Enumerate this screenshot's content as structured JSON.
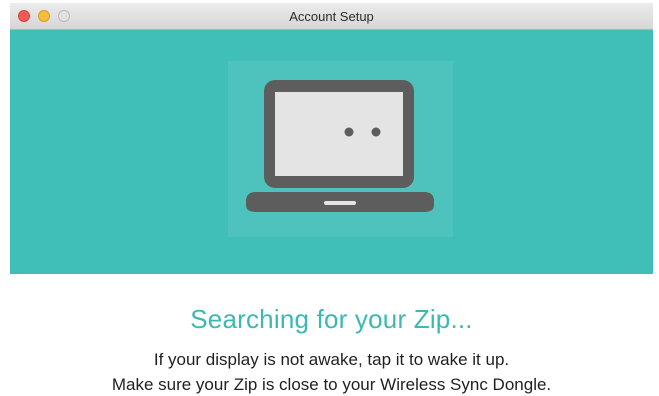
{
  "window": {
    "title": "Account Setup",
    "hero_color": "#3fbfb8"
  },
  "illustration": {
    "icon": "laptop-icon"
  },
  "content": {
    "heading": "Searching for your Zip...",
    "line1": "If your display is not awake, tap it to wake it up.",
    "line2": "Make sure your Zip is close to your Wireless Sync Dongle."
  }
}
